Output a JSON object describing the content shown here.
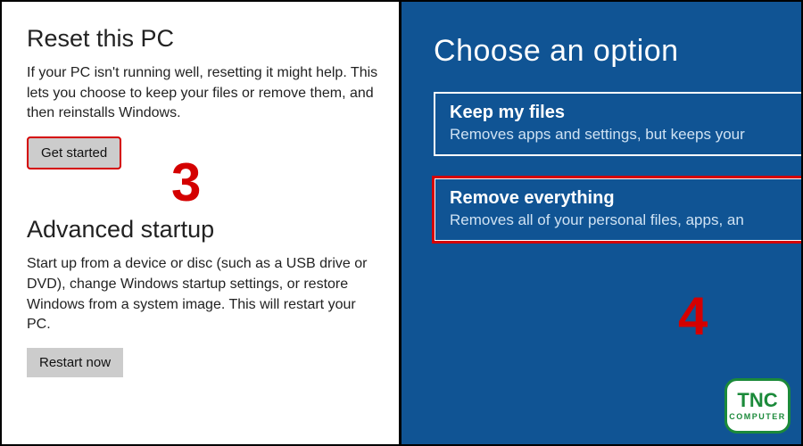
{
  "left": {
    "reset": {
      "heading": "Reset this PC",
      "desc": "If your PC isn't running well, resetting it might help. This lets you choose to keep your files or remove them, and then reinstalls Windows.",
      "button_label": "Get started"
    },
    "step_number_3": "3",
    "advanced": {
      "heading": "Advanced startup",
      "desc": "Start up from a device or disc (such as a USB drive or DVD), change Windows startup settings, or restore Windows from a system image. This will restart your PC.",
      "button_label": "Restart now"
    }
  },
  "right": {
    "heading": "Choose an option",
    "options": [
      {
        "title": "Keep my files",
        "desc": "Removes apps and settings, but keeps your"
      },
      {
        "title": "Remove everything",
        "desc": "Removes all of your personal files, apps, an"
      }
    ],
    "step_number_4": "4"
  },
  "logo": {
    "text": "TNC",
    "sub": "COMPUTER"
  }
}
